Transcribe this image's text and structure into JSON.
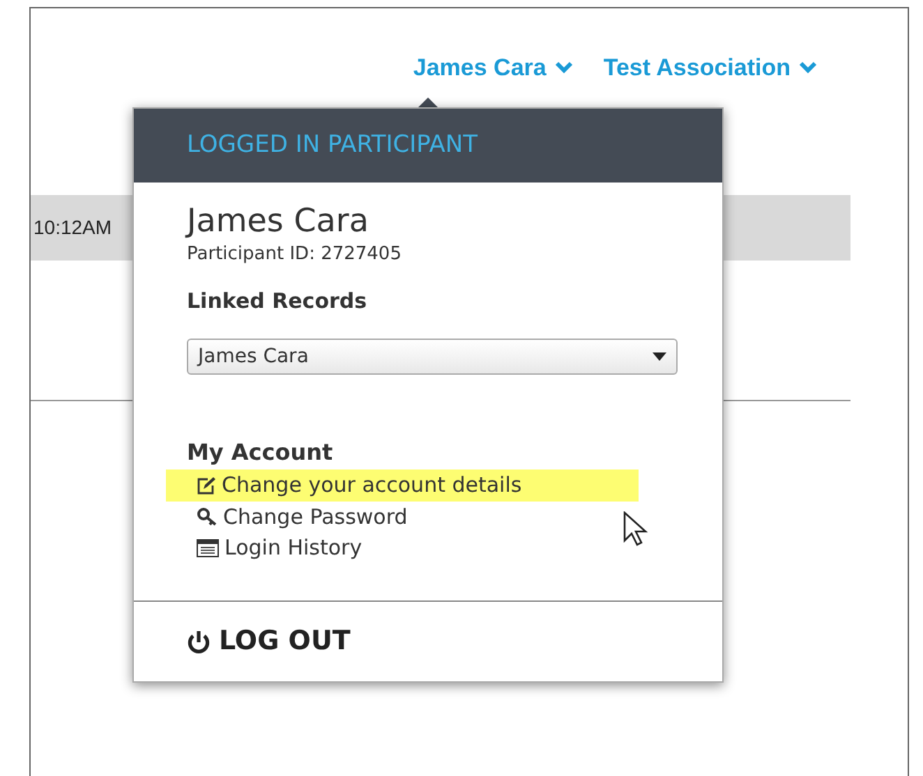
{
  "nav": [
    {
      "label": "James Cara"
    },
    {
      "label": "Test Association"
    }
  ],
  "background_row": {
    "time": "10:12AM"
  },
  "dropdown": {
    "header": "LOGGED IN PARTICIPANT",
    "name": "James Cara",
    "participant_id": "Participant ID: 2727405",
    "linked_records": {
      "label": "Linked Records",
      "value": "James Cara"
    },
    "account": {
      "heading": "My Account",
      "items": [
        {
          "kind": "edit",
          "label": "Change your account details",
          "highlighted": true
        },
        {
          "kind": "key",
          "label": "Change Password",
          "highlighted": false
        },
        {
          "kind": "list",
          "label": "Login History",
          "highlighted": false
        }
      ]
    },
    "logout": "LOG OUT"
  }
}
